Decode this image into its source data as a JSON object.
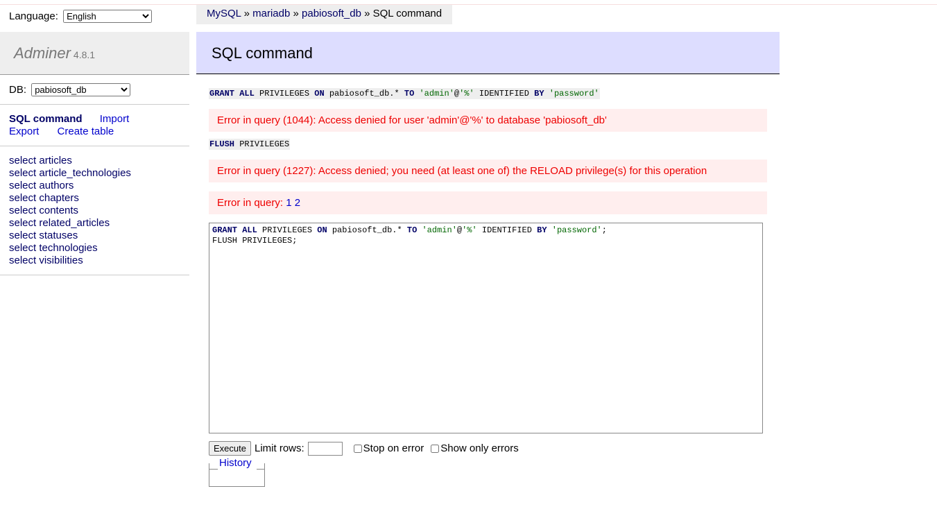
{
  "language": {
    "label": "Language:",
    "selected": "English"
  },
  "logo": {
    "name": "Adminer",
    "version": "4.8.1"
  },
  "db": {
    "label": "DB:",
    "selected": "pabiosoft_db"
  },
  "menu": {
    "sql_command": "SQL command",
    "import": "Import",
    "export": "Export",
    "create_table": "Create table"
  },
  "tables": [
    "select articles",
    "select article_technologies",
    "select authors",
    "select chapters",
    "select contents",
    "select related_articles",
    "select statuses",
    "select technologies",
    "select visibilities"
  ],
  "breadcrumb": {
    "mysql": "MySQL",
    "server": "mariadb",
    "database": "pabiosoft_db",
    "current": "SQL command",
    "sep": "»"
  },
  "page_title": "SQL command",
  "query1": {
    "kw1": "GRANT",
    "kw2": "ALL",
    "t1": " PRIVILEGES ",
    "kw3": "ON",
    "t2": " pabiosoft_db.* ",
    "kw4": "TO",
    "s1": "'admin'",
    "t3": "@",
    "s2": "'%'",
    "t4": " IDENTIFIED ",
    "kw5": "BY",
    "s3": "'password'"
  },
  "error1": "Error in query (1044): Access denied for user 'admin'@'%' to database 'pabiosoft_db'",
  "query2": {
    "kw1": "FLUSH",
    "t1": " PRIVILEGES"
  },
  "error2": "Error in query (1227): Access denied; you need (at least one of) the RELOAD privilege(s) for this operation",
  "error3": {
    "label": "Error in query:",
    "link1": "1",
    "link2": "2"
  },
  "textarea": {
    "line2": "FLUSH PRIVILEGES;"
  },
  "controls": {
    "execute": "Execute",
    "limit_rows": "Limit rows:",
    "limit_value": "",
    "stop_on_error": "Stop on error",
    "show_only_errors": "Show only errors"
  },
  "history": "History"
}
